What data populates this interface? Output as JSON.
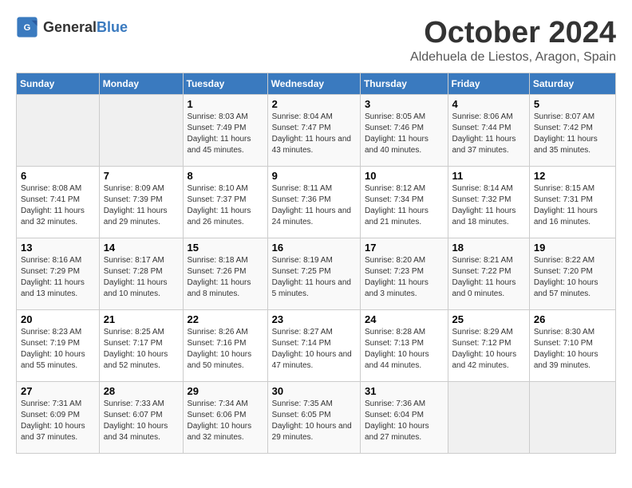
{
  "header": {
    "logo_general": "General",
    "logo_blue": "Blue",
    "title": "October 2024",
    "subtitle": "Aldehuela de Liestos, Aragon, Spain"
  },
  "days_of_week": [
    "Sunday",
    "Monday",
    "Tuesday",
    "Wednesday",
    "Thursday",
    "Friday",
    "Saturday"
  ],
  "weeks": [
    [
      {
        "day": "",
        "sunrise": "",
        "sunset": "",
        "daylight": "",
        "empty": true
      },
      {
        "day": "",
        "sunrise": "",
        "sunset": "",
        "daylight": "",
        "empty": true
      },
      {
        "day": "1",
        "sunrise": "Sunrise: 8:03 AM",
        "sunset": "Sunset: 7:49 PM",
        "daylight": "Daylight: 11 hours and 45 minutes."
      },
      {
        "day": "2",
        "sunrise": "Sunrise: 8:04 AM",
        "sunset": "Sunset: 7:47 PM",
        "daylight": "Daylight: 11 hours and 43 minutes."
      },
      {
        "day": "3",
        "sunrise": "Sunrise: 8:05 AM",
        "sunset": "Sunset: 7:46 PM",
        "daylight": "Daylight: 11 hours and 40 minutes."
      },
      {
        "day": "4",
        "sunrise": "Sunrise: 8:06 AM",
        "sunset": "Sunset: 7:44 PM",
        "daylight": "Daylight: 11 hours and 37 minutes."
      },
      {
        "day": "5",
        "sunrise": "Sunrise: 8:07 AM",
        "sunset": "Sunset: 7:42 PM",
        "daylight": "Daylight: 11 hours and 35 minutes."
      }
    ],
    [
      {
        "day": "6",
        "sunrise": "Sunrise: 8:08 AM",
        "sunset": "Sunset: 7:41 PM",
        "daylight": "Daylight: 11 hours and 32 minutes."
      },
      {
        "day": "7",
        "sunrise": "Sunrise: 8:09 AM",
        "sunset": "Sunset: 7:39 PM",
        "daylight": "Daylight: 11 hours and 29 minutes."
      },
      {
        "day": "8",
        "sunrise": "Sunrise: 8:10 AM",
        "sunset": "Sunset: 7:37 PM",
        "daylight": "Daylight: 11 hours and 26 minutes."
      },
      {
        "day": "9",
        "sunrise": "Sunrise: 8:11 AM",
        "sunset": "Sunset: 7:36 PM",
        "daylight": "Daylight: 11 hours and 24 minutes."
      },
      {
        "day": "10",
        "sunrise": "Sunrise: 8:12 AM",
        "sunset": "Sunset: 7:34 PM",
        "daylight": "Daylight: 11 hours and 21 minutes."
      },
      {
        "day": "11",
        "sunrise": "Sunrise: 8:14 AM",
        "sunset": "Sunset: 7:32 PM",
        "daylight": "Daylight: 11 hours and 18 minutes."
      },
      {
        "day": "12",
        "sunrise": "Sunrise: 8:15 AM",
        "sunset": "Sunset: 7:31 PM",
        "daylight": "Daylight: 11 hours and 16 minutes."
      }
    ],
    [
      {
        "day": "13",
        "sunrise": "Sunrise: 8:16 AM",
        "sunset": "Sunset: 7:29 PM",
        "daylight": "Daylight: 11 hours and 13 minutes."
      },
      {
        "day": "14",
        "sunrise": "Sunrise: 8:17 AM",
        "sunset": "Sunset: 7:28 PM",
        "daylight": "Daylight: 11 hours and 10 minutes."
      },
      {
        "day": "15",
        "sunrise": "Sunrise: 8:18 AM",
        "sunset": "Sunset: 7:26 PM",
        "daylight": "Daylight: 11 hours and 8 minutes."
      },
      {
        "day": "16",
        "sunrise": "Sunrise: 8:19 AM",
        "sunset": "Sunset: 7:25 PM",
        "daylight": "Daylight: 11 hours and 5 minutes."
      },
      {
        "day": "17",
        "sunrise": "Sunrise: 8:20 AM",
        "sunset": "Sunset: 7:23 PM",
        "daylight": "Daylight: 11 hours and 3 minutes."
      },
      {
        "day": "18",
        "sunrise": "Sunrise: 8:21 AM",
        "sunset": "Sunset: 7:22 PM",
        "daylight": "Daylight: 11 hours and 0 minutes."
      },
      {
        "day": "19",
        "sunrise": "Sunrise: 8:22 AM",
        "sunset": "Sunset: 7:20 PM",
        "daylight": "Daylight: 10 hours and 57 minutes."
      }
    ],
    [
      {
        "day": "20",
        "sunrise": "Sunrise: 8:23 AM",
        "sunset": "Sunset: 7:19 PM",
        "daylight": "Daylight: 10 hours and 55 minutes."
      },
      {
        "day": "21",
        "sunrise": "Sunrise: 8:25 AM",
        "sunset": "Sunset: 7:17 PM",
        "daylight": "Daylight: 10 hours and 52 minutes."
      },
      {
        "day": "22",
        "sunrise": "Sunrise: 8:26 AM",
        "sunset": "Sunset: 7:16 PM",
        "daylight": "Daylight: 10 hours and 50 minutes."
      },
      {
        "day": "23",
        "sunrise": "Sunrise: 8:27 AM",
        "sunset": "Sunset: 7:14 PM",
        "daylight": "Daylight: 10 hours and 47 minutes."
      },
      {
        "day": "24",
        "sunrise": "Sunrise: 8:28 AM",
        "sunset": "Sunset: 7:13 PM",
        "daylight": "Daylight: 10 hours and 44 minutes."
      },
      {
        "day": "25",
        "sunrise": "Sunrise: 8:29 AM",
        "sunset": "Sunset: 7:12 PM",
        "daylight": "Daylight: 10 hours and 42 minutes."
      },
      {
        "day": "26",
        "sunrise": "Sunrise: 8:30 AM",
        "sunset": "Sunset: 7:10 PM",
        "daylight": "Daylight: 10 hours and 39 minutes."
      }
    ],
    [
      {
        "day": "27",
        "sunrise": "Sunrise: 7:31 AM",
        "sunset": "Sunset: 6:09 PM",
        "daylight": "Daylight: 10 hours and 37 minutes."
      },
      {
        "day": "28",
        "sunrise": "Sunrise: 7:33 AM",
        "sunset": "Sunset: 6:07 PM",
        "daylight": "Daylight: 10 hours and 34 minutes."
      },
      {
        "day": "29",
        "sunrise": "Sunrise: 7:34 AM",
        "sunset": "Sunset: 6:06 PM",
        "daylight": "Daylight: 10 hours and 32 minutes."
      },
      {
        "day": "30",
        "sunrise": "Sunrise: 7:35 AM",
        "sunset": "Sunset: 6:05 PM",
        "daylight": "Daylight: 10 hours and 29 minutes."
      },
      {
        "day": "31",
        "sunrise": "Sunrise: 7:36 AM",
        "sunset": "Sunset: 6:04 PM",
        "daylight": "Daylight: 10 hours and 27 minutes."
      },
      {
        "day": "",
        "sunrise": "",
        "sunset": "",
        "daylight": "",
        "empty": true
      },
      {
        "day": "",
        "sunrise": "",
        "sunset": "",
        "daylight": "",
        "empty": true
      }
    ]
  ]
}
